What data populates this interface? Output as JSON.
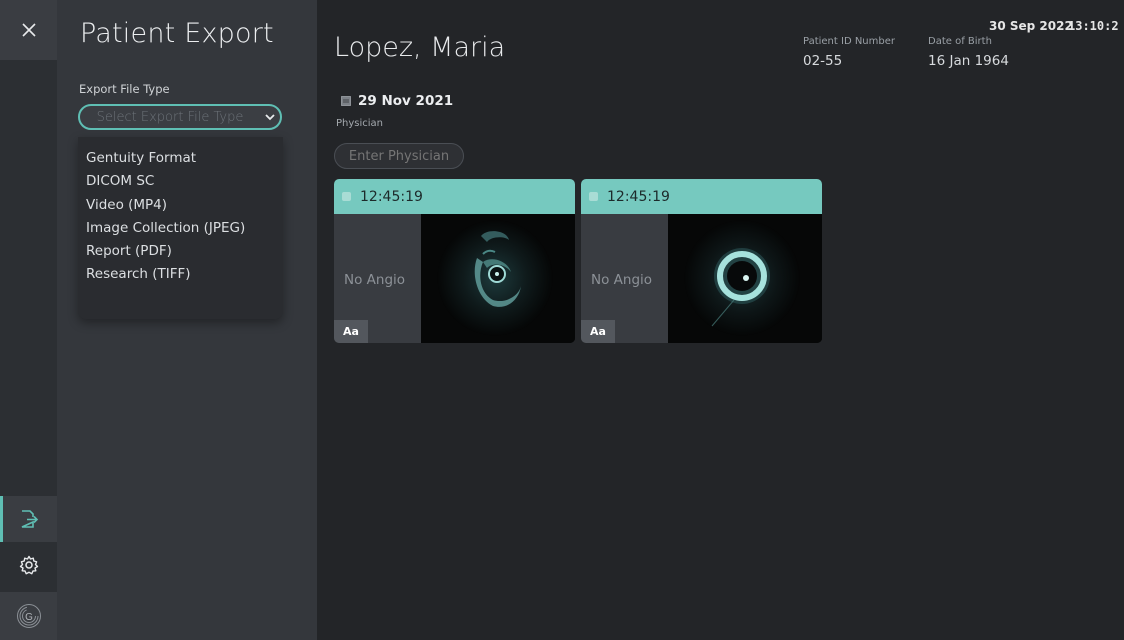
{
  "rail": {
    "close_icon": "close-icon",
    "export_icon": "export-icon",
    "settings_icon": "gear-icon",
    "logo_text": "G"
  },
  "panel": {
    "title": "Patient Export",
    "field_label": "Export File Type",
    "select_placeholder": "Select Export File Type",
    "options": [
      "Gentuity Format",
      "DICOM SC",
      "Video (MP4)",
      "Image Collection (JPEG)",
      "Report (PDF)",
      "Research (TIFF)"
    ]
  },
  "header": {
    "patient_name": "Lopez, Maria",
    "patient_id_label": "Patient ID Number",
    "patient_id": "02-55",
    "dob_label": "Date of Birth",
    "dob": "16 Jan 1964",
    "current_date": "30 Sep 2022",
    "current_time": "13:10:2"
  },
  "session": {
    "date": "29 Nov 2021",
    "physician_label": "Physician",
    "physician_placeholder": "Enter Physician"
  },
  "cards": [
    {
      "time": "12:45:19",
      "angio": "No Angio",
      "aa": "Aa"
    },
    {
      "time": "12:45:19",
      "angio": "No Angio",
      "aa": "Aa"
    }
  ],
  "colors": {
    "accent": "#5fbfb4",
    "card_header": "#76c9bf",
    "panel": "#34373c",
    "background": "#232528"
  }
}
